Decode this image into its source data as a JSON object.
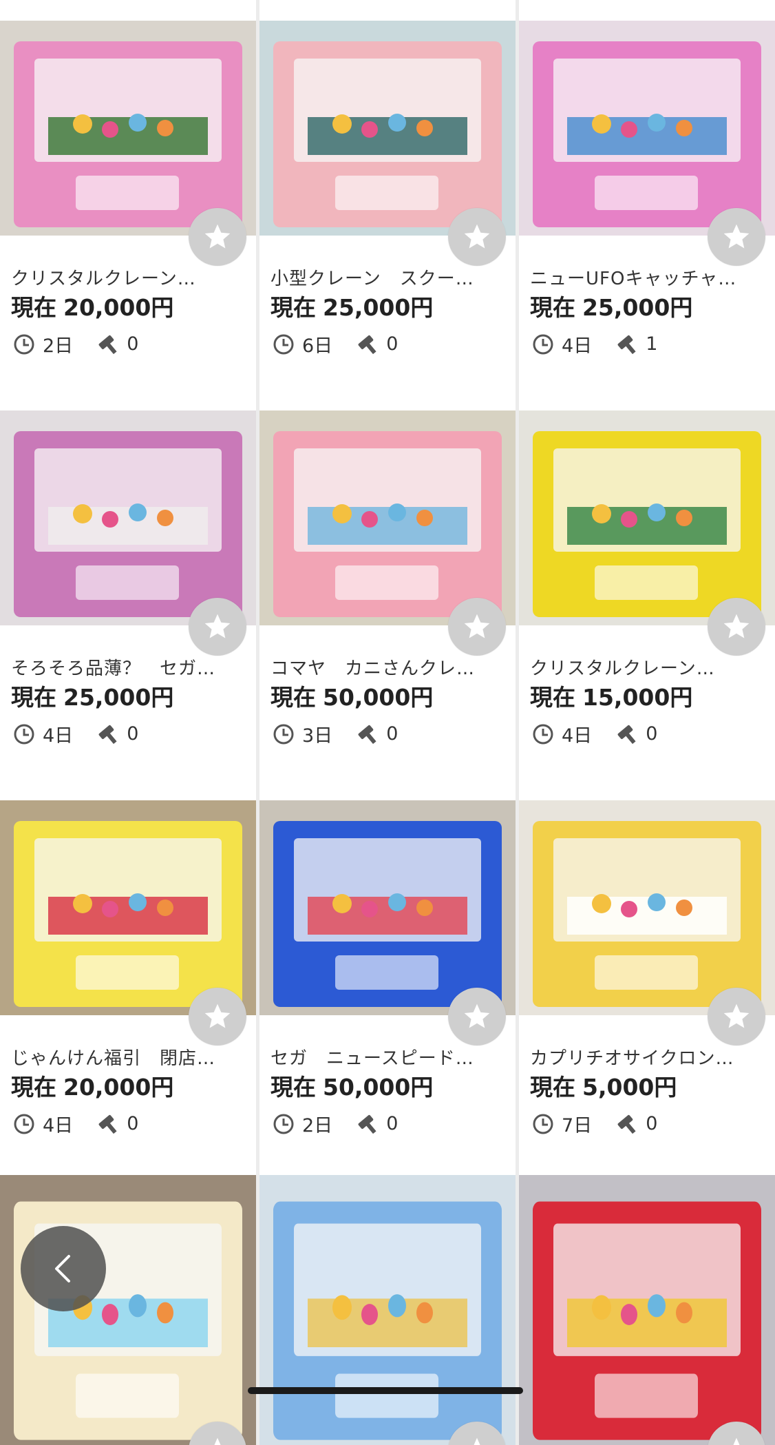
{
  "items": [
    {
      "title": "クリスタルクレーン…",
      "price_prefix": "現在",
      "price": "20,000円",
      "time": "2日",
      "bids": "0",
      "colors": {
        "bg": "#d9d4cc",
        "main": "#e98fc2",
        "accent": "#3f7b3c"
      }
    },
    {
      "title": "小型クレーン　スクー…",
      "price_prefix": "現在",
      "price": "25,000円",
      "time": "6日",
      "bids": "0",
      "colors": {
        "bg": "#c9d9dc",
        "main": "#f1b6bd",
        "accent": "#3a6e6e"
      }
    },
    {
      "title": "ニューUFOキャッチャ…",
      "price_prefix": "現在",
      "price": "25,000円",
      "time": "4日",
      "bids": "1",
      "colors": {
        "bg": "#e7dbe4",
        "main": "#e681c6",
        "accent": "#4e8fd0"
      }
    },
    {
      "title": "そろそろ品薄？　セガ…",
      "price_prefix": "現在",
      "price": "25,000円",
      "time": "4日",
      "bids": "0",
      "colors": {
        "bg": "#e2dde0",
        "main": "#c979b8",
        "accent": "#f0ecec"
      }
    },
    {
      "title": "コマヤ　カニさんクレ…",
      "price_prefix": "現在",
      "price": "50,000円",
      "time": "3日",
      "bids": "0",
      "colors": {
        "bg": "#d7d2c2",
        "main": "#f2a4b5",
        "accent": "#79b9de"
      }
    },
    {
      "title": "クリスタルクレーン…",
      "price_prefix": "現在",
      "price": "15,000円",
      "time": "4日",
      "bids": "0",
      "colors": {
        "bg": "#e4e3dc",
        "main": "#eed824",
        "accent": "#3d8a4b"
      }
    },
    {
      "title": "じゃんけん福引　閉店…",
      "price_prefix": "現在",
      "price": "20,000円",
      "time": "4日",
      "bids": "0",
      "colors": {
        "bg": "#b6a586",
        "main": "#f4e24a",
        "accent": "#d93b4a"
      }
    },
    {
      "title": "セガ　ニュースピード…",
      "price_prefix": "現在",
      "price": "50,000円",
      "time": "2日",
      "bids": "0",
      "colors": {
        "bg": "#c9c3b8",
        "main": "#2c5ad4",
        "accent": "#e24d5c"
      }
    },
    {
      "title": "カプリチオサイクロン…",
      "price_prefix": "現在",
      "price": "5,000円",
      "time": "7日",
      "bids": "0",
      "colors": {
        "bg": "#e8e4dc",
        "main": "#f2d04a",
        "accent": "#ffffff"
      }
    },
    {
      "title": "",
      "price_prefix": "",
      "price": "",
      "time": "",
      "bids": "",
      "colors": {
        "bg": "#9a8a78",
        "main": "#f4e9c8",
        "accent": "#8fd6f0"
      }
    },
    {
      "title": "",
      "price_prefix": "",
      "price": "",
      "time": "",
      "bids": "",
      "colors": {
        "bg": "#d4e0e8",
        "main": "#7fb3e6",
        "accent": "#eac65a"
      }
    },
    {
      "title": "",
      "price_prefix": "",
      "price": "",
      "time": "",
      "bids": "",
      "colors": {
        "bg": "#c2c0c6",
        "main": "#d92b3a",
        "accent": "#f0c83c"
      }
    }
  ],
  "overlay": {
    "back_icon": "chevron-left-icon",
    "home_indicator": true
  }
}
